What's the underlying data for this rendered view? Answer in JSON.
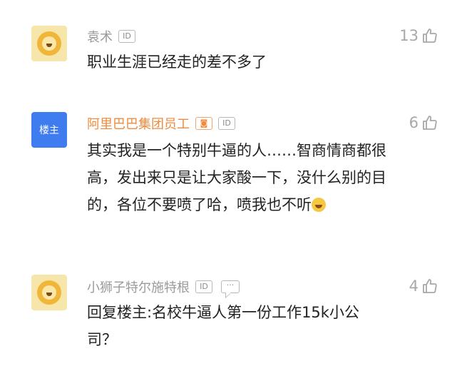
{
  "comments": [
    {
      "author": "袁术",
      "badge": "ID",
      "likes": "13",
      "text": "职业生涯已经走的差不多了",
      "avatar": "lion-avatar"
    },
    {
      "author": "阿里巴巴集团员工",
      "author_badge": "◙",
      "badge": "ID",
      "likes": "6",
      "avatar_label": "楼主",
      "text": "其实我是一个特别牛逼的人……智商情商都很高，发出来只是让大家酸一下，没什么别的目的，各位不要喷了哈，喷我也不听",
      "emoji": "laughing-emoji"
    },
    {
      "author": "小狮子特尔施特根",
      "badge": "ID",
      "chat_badge": "···",
      "likes": "4",
      "text": "回复楼主:名校牛逼人第一份工作15k小公司？",
      "avatar": "lion-avatar"
    }
  ],
  "colors": {
    "name_gray": "#9a9a9a",
    "name_orange": "#f08a3c",
    "owner_blue": "#3f7cf0",
    "text": "#222222"
  }
}
